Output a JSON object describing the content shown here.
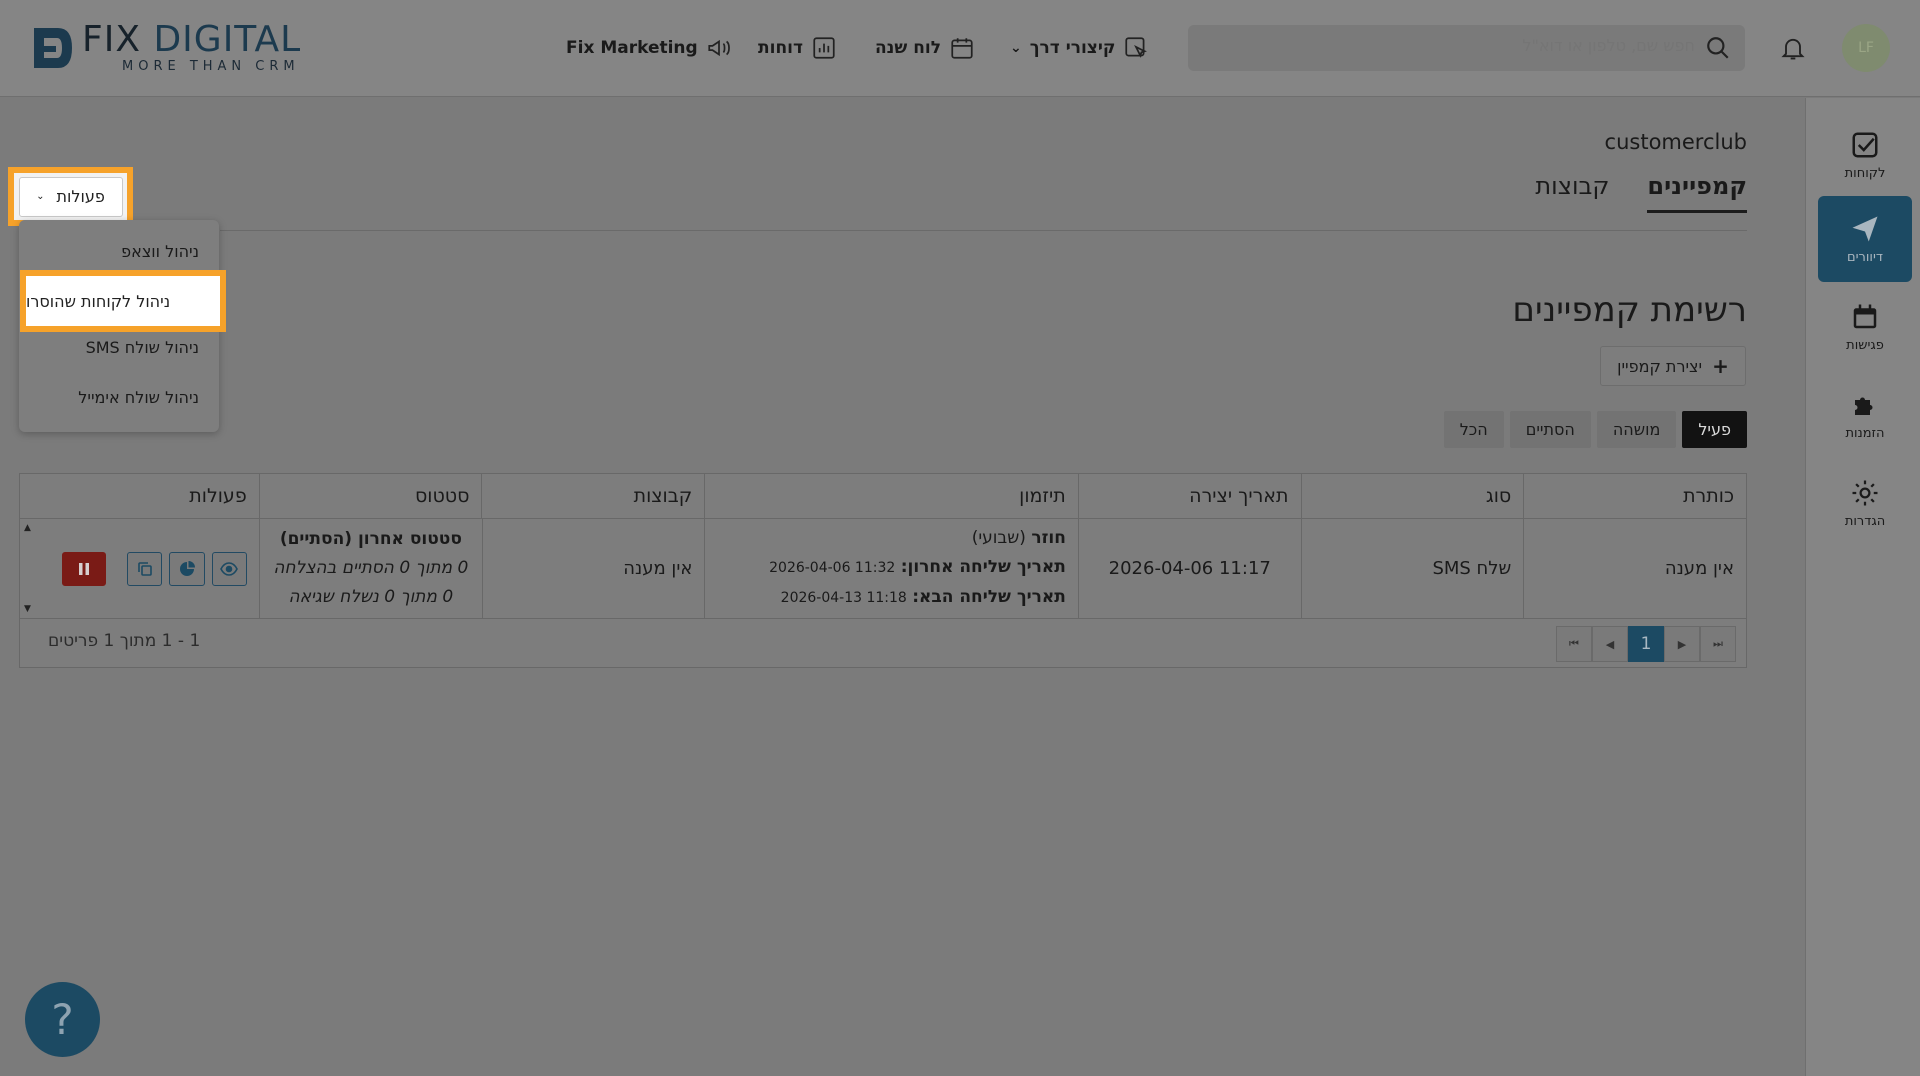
{
  "brand": {
    "name_part1": "FIX",
    "name_part2": "DIGITAL",
    "tagline": "MORE THAN CRM"
  },
  "nav": {
    "marketing": "Fix Marketing",
    "reports": "דוחות",
    "calendar": "לוח שנה",
    "shortcuts": "קיצורי דרך"
  },
  "search": {
    "placeholder": "חפש שם, טלפון או דוא\"ל"
  },
  "user": {
    "initials": "LF"
  },
  "sidebar": {
    "items": [
      {
        "label": "לקוחות",
        "icon": "check-square-icon"
      },
      {
        "label": "דיוורים",
        "icon": "paper-plane-icon"
      },
      {
        "label": "פגישות",
        "icon": "calendar-icon"
      },
      {
        "label": "הזמנות",
        "icon": "puzzle-icon"
      },
      {
        "label": "הגדרות",
        "icon": "gear-icon"
      }
    ],
    "active_index": 1
  },
  "page": {
    "label": "customerclub",
    "title": "רשימת קמפיינים"
  },
  "tabs": [
    {
      "label": "קמפיינים"
    },
    {
      "label": "קבוצות"
    }
  ],
  "create_button": {
    "label": "יצירת קמפיין"
  },
  "filters": [
    {
      "label": "פעיל"
    },
    {
      "label": "מושהה"
    },
    {
      "label": "הסתיים"
    },
    {
      "label": "הכל"
    }
  ],
  "actions_dropdown": {
    "label": "פעולות",
    "items": [
      "ניהול ווצאפ",
      "ניהול לקוחות שהוסרו",
      "ניהול שולח SMS",
      "ניהול שולח אימייל"
    ]
  },
  "table": {
    "headers": [
      "כותרת",
      "סוג",
      "תאריך יצירה",
      "תיזמון",
      "קבוצות",
      "סטטוס",
      "פעולות"
    ],
    "rows": [
      {
        "title": "אין מענה",
        "type": "שלח SMS",
        "created": "2026-04-06 11:17",
        "schedule": {
          "recurring_label": "חוזר",
          "recurring_value": "(שבועי)",
          "last_label": "תאריך שליחה אחרון:",
          "last_value": "2026-04-06 11:32",
          "next_label": "תאריך שליחה הבא:",
          "next_value": "2026-04-13 11:18"
        },
        "groups": "אין מענה",
        "status": {
          "headline": "סטטוס אחרון (הסתיים)",
          "line1": "0 מתוך 0 הסתיים בהצלחה",
          "line2": "0 מתוך 0 נשלח שגיאה"
        }
      }
    ],
    "pagination": {
      "current": "1",
      "summary": "1 - 1 מתוך 1 פריטים"
    }
  },
  "help": {
    "label": "?"
  },
  "colors": {
    "primary": "#1c4a63",
    "highlight": "#f6a22a",
    "pause": "#7a1b16"
  }
}
